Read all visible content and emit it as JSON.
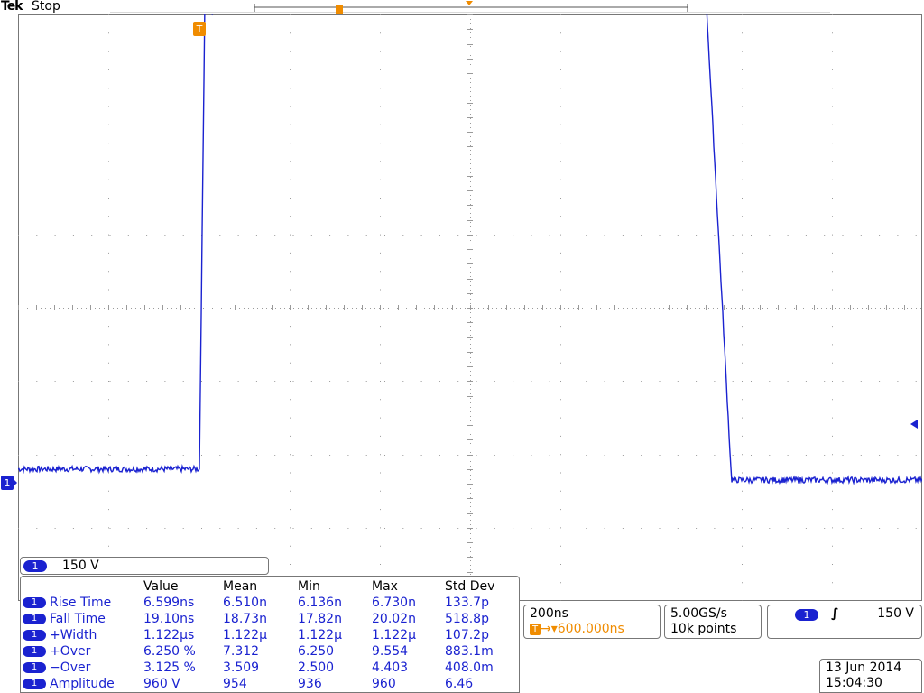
{
  "header": {
    "brand": "Tek",
    "acquisition_state": "Stop"
  },
  "waveform": {
    "channel": "1",
    "trigger_marker": "T",
    "trigger_position_time_ns": 600,
    "time_per_division_ns": 200,
    "volts_per_division": 150,
    "trace_color": "#1a22d0",
    "trigger_color": "#f08c00",
    "shape": {
      "baseline_level_divisions": -2.2,
      "high_level_divisions": 4.2,
      "low_after_fall_divisions": -2.35,
      "rise_time_ns": 6.599,
      "pulse_width_us": 1.122,
      "fall_time_ns": 19.1
    }
  },
  "channel_scale": {
    "channel": "1",
    "value": "150 V"
  },
  "measurements": {
    "headers": [
      "",
      "Value",
      "Mean",
      "Min",
      "Max",
      "Std Dev"
    ],
    "rows": [
      {
        "channel": "1",
        "name": "Rise Time",
        "value": "6.599ns",
        "mean": "6.510n",
        "min": "6.136n",
        "max": "6.730n",
        "std_dev": "133.7p"
      },
      {
        "channel": "1",
        "name": "Fall Time",
        "value": "19.10ns",
        "mean": "18.73n",
        "min": "17.82n",
        "max": "20.02n",
        "std_dev": "518.8p"
      },
      {
        "channel": "1",
        "name": "+Width",
        "value": "1.122µs",
        "mean": "1.122µ",
        "min": "1.122µ",
        "max": "1.122µ",
        "std_dev": "107.2p"
      },
      {
        "channel": "1",
        "name": "+Over",
        "value": "6.250 %",
        "mean": "7.312",
        "min": "6.250",
        "max": "9.554",
        "std_dev": "883.1m"
      },
      {
        "channel": "1",
        "name": "−Over",
        "value": "3.125 %",
        "mean": "3.509",
        "min": "2.500",
        "max": "4.403",
        "std_dev": "408.0m"
      },
      {
        "channel": "1",
        "name": "Amplitude",
        "value": "960 V",
        "mean": "954",
        "min": "936",
        "max": "960",
        "std_dev": "6.46"
      }
    ]
  },
  "timebase": {
    "scale": "200ns",
    "trigger_marker": "T",
    "position": "600.000ns"
  },
  "acquisition": {
    "sample_rate": "5.00GS/s",
    "record_length": "10k points"
  },
  "trigger": {
    "channel": "1",
    "slope_symbol": "∫",
    "level": "150 V"
  },
  "datetime": {
    "date": "13 Jun  2014",
    "time": "15:04:30"
  }
}
